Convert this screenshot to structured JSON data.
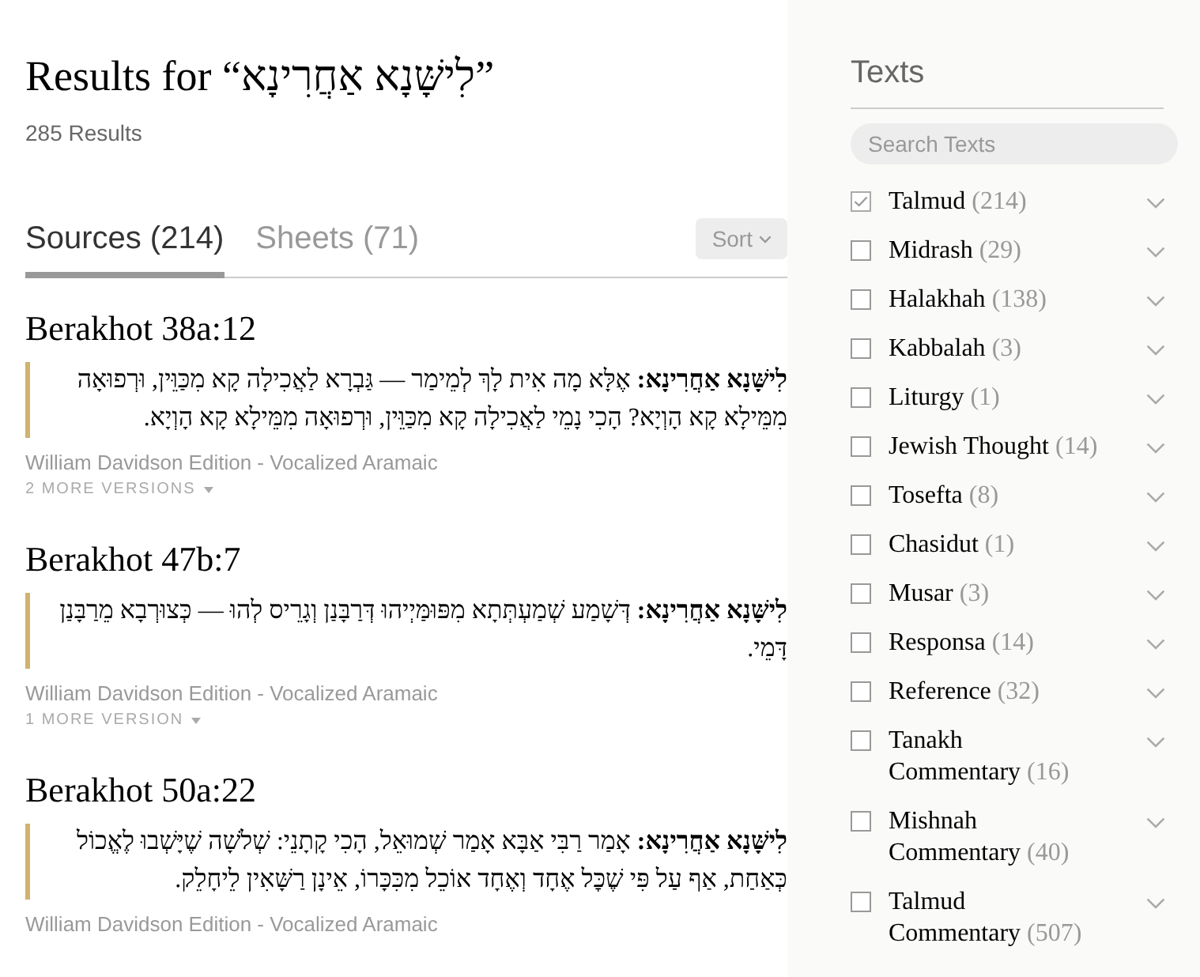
{
  "header": {
    "title": "Results for “לִישָּׁנָא אַחֲרִינָא”",
    "count": "285 Results"
  },
  "tabs": [
    {
      "label": "Sources (214)",
      "selected": true
    },
    {
      "label": "Sheets (71)",
      "selected": false
    }
  ],
  "sort_button": {
    "label": "Sort"
  },
  "results": [
    {
      "title": "Berakhot 38a:12",
      "text": "**לִישָּׁנָא אַחֲרִינָא:** אֶלָּא מָה אִית לָךְ לְמֵימַר — גַּבְרָא לַאֲכִילָה קָא מִכַּוֵּין, וּרְפוּאָה מִמֵּילָא קָא הָוְיָא? הָכִי נָמֵי לַאֲכִילָה קָא מִכַּוֵּין, וּרְפוּאָה מִמֵּילָא קָא הָוְיָא.",
      "edition": "William Davidson Edition - Vocalized Aramaic",
      "more_versions": "2 MORE VERSIONS"
    },
    {
      "title": "Berakhot 47b:7",
      "text": "**לִישָּׁנָא אַחֲרִינָא:** דְּשָׁמַע שְׁמַעְתְּתָא מִפּוּמַּיְיהוּ דְּרַבָּנַן וְגָרֵיס לְהוּ — כְּצוּרְבָא מֵרַבָּנַן דָּמֵי.",
      "edition": "William Davidson Edition - Vocalized Aramaic",
      "more_versions": "1 MORE VERSION"
    },
    {
      "title": "Berakhot 50a:22",
      "text": "**לִישָּׁנָא אַחֲרִינָא:** אָמַר רַבִּי אַבָּא אָמַר שְׁמוּאֵל, הָכִי קָתָנֵי: שְׁלֹשָׁה שֶׁיָּשְׁבוּ לֶאֱכוֹל כְּאַחַת, אַף עַל פִּי שֶׁכׇּל אֶחָד וְאֶחָד אוֹכֵל מִכִּכָּרוֹ, אֵינָן רַשָּׁאִין לֵיחָלֵק.",
      "edition": "William Davidson Edition - Vocalized Aramaic"
    }
  ],
  "sidebar": {
    "title": "Texts",
    "search": {
      "placeholder": "Search Texts"
    },
    "filters": [
      {
        "name": "Talmud",
        "count": "(214)",
        "checked": true
      },
      {
        "name": "Midrash",
        "count": "(29)",
        "checked": false
      },
      {
        "name": "Halakhah",
        "count": "(138)",
        "checked": false
      },
      {
        "name": "Kabbalah",
        "count": "(3)",
        "checked": false
      },
      {
        "name": "Liturgy",
        "count": "(1)",
        "checked": false
      },
      {
        "name": "Jewish Thought",
        "count": "(14)",
        "checked": false
      },
      {
        "name": "Tosefta",
        "count": "(8)",
        "checked": false
      },
      {
        "name": "Chasidut",
        "count": "(1)",
        "checked": false
      },
      {
        "name": "Musar",
        "count": "(3)",
        "checked": false
      },
      {
        "name": "Responsa",
        "count": "(14)",
        "checked": false
      },
      {
        "name": "Reference",
        "count": "(32)",
        "checked": false
      },
      {
        "name": "Tanakh Commentary",
        "count": "(16)",
        "checked": false
      },
      {
        "name": "Mishnah Commentary",
        "count": "(40)",
        "checked": false
      },
      {
        "name": "Talmud Commentary",
        "count": "(507)",
        "checked": false
      }
    ]
  }
}
